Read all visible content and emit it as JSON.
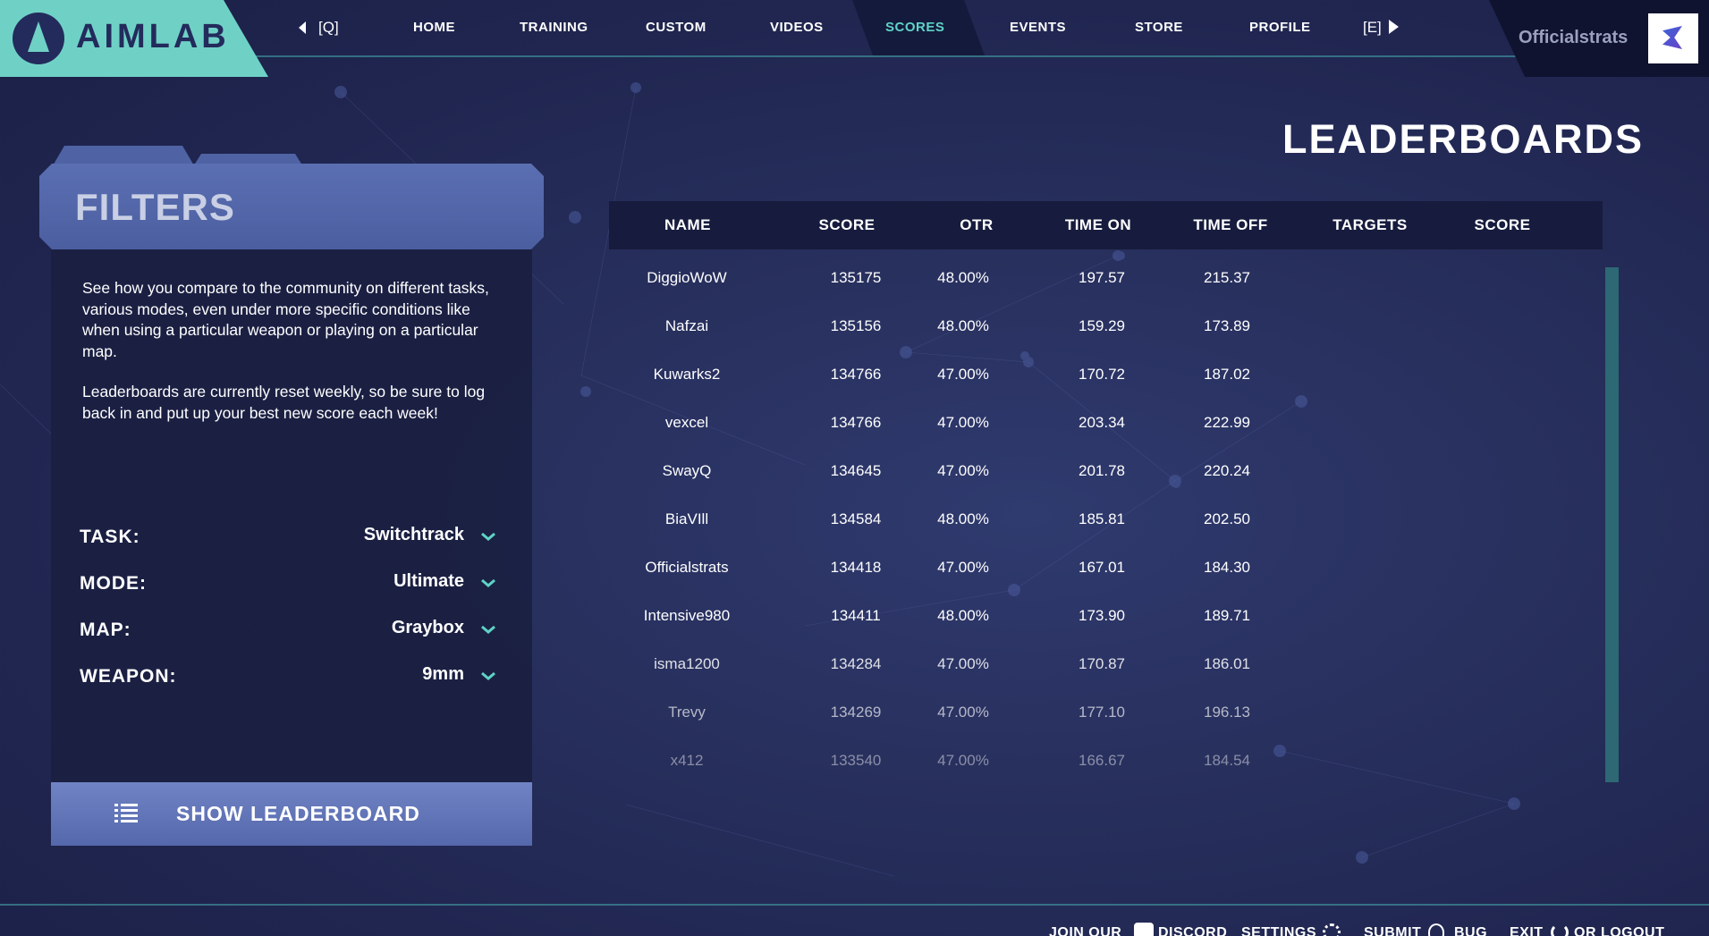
{
  "app": {
    "logo_text": "AIMLAB"
  },
  "nav": {
    "prev_key": "[Q]",
    "next_key": "[E]",
    "items": [
      {
        "label": "HOME"
      },
      {
        "label": "TRAINING"
      },
      {
        "label": "CUSTOM"
      },
      {
        "label": "VIDEOS"
      },
      {
        "label": "SCORES",
        "active": true
      },
      {
        "label": "EVENTS"
      },
      {
        "label": "STORE"
      },
      {
        "label": "PROFILE"
      }
    ],
    "username": "Officialstrats"
  },
  "filters": {
    "title": "FILTERS",
    "description_1": "See how you compare to the community on different tasks, various  modes, even under more specific conditions like when using a particular weapon or playing on a particular map.",
    "description_2": "Leaderboards are currently reset weekly, so be sure to log back in and put up your best new score each week!",
    "fields": [
      {
        "label": "TASK:",
        "value": "Switchtrack"
      },
      {
        "label": "MODE:",
        "value": "Ultimate"
      },
      {
        "label": "MAP:",
        "value": "Graybox"
      },
      {
        "label": "WEAPON:",
        "value": "9mm"
      }
    ],
    "show_button": "SHOW LEADERBOARD"
  },
  "leaderboard": {
    "title": "LEADERBOARDS",
    "columns": [
      "NAME",
      "SCORE",
      "OTR",
      "TIME ON",
      "TIME OFF",
      "TARGETS",
      "SCORE"
    ],
    "rows": [
      [
        "DiggioWoW",
        "135175",
        "48.00%",
        "197.57",
        "215.37"
      ],
      [
        "Nafzai",
        "135156",
        "48.00%",
        "159.29",
        "173.89"
      ],
      [
        "Kuwarks2",
        "134766",
        "47.00%",
        "170.72",
        "187.02"
      ],
      [
        "vexcel",
        "134766",
        "47.00%",
        "203.34",
        "222.99"
      ],
      [
        "SwayQ",
        "134645",
        "47.00%",
        "201.78",
        "220.24"
      ],
      [
        "BiaVIll",
        "134584",
        "48.00%",
        "185.81",
        "202.50"
      ],
      [
        "Officialstrats",
        "134418",
        "47.00%",
        "167.01",
        "184.30"
      ],
      [
        "Intensive980",
        "134411",
        "48.00%",
        "173.90",
        "189.71"
      ],
      [
        "isma1200",
        "134284",
        "47.00%",
        "170.87",
        "186.01"
      ],
      [
        "Trevy",
        "134269",
        "47.00%",
        "177.10",
        "196.13"
      ],
      [
        "x412",
        "133540",
        "47.00%",
        "166.67",
        "184.54"
      ]
    ]
  },
  "footer": {
    "join_our": "JOIN OUR",
    "discord": "DISCORD",
    "settings": "SETTINGS",
    "submit": "SUBMIT",
    "bug": "BUG",
    "exit": "EXIT",
    "or_logout": "OR LOGOUT"
  },
  "colors": {
    "accent_teal": "#5fd3c6",
    "logo_bg": "#6fd1c6",
    "panel_header": "#5a6fb2",
    "panel_body": "#1b2043",
    "page_bg": "#28305e"
  }
}
